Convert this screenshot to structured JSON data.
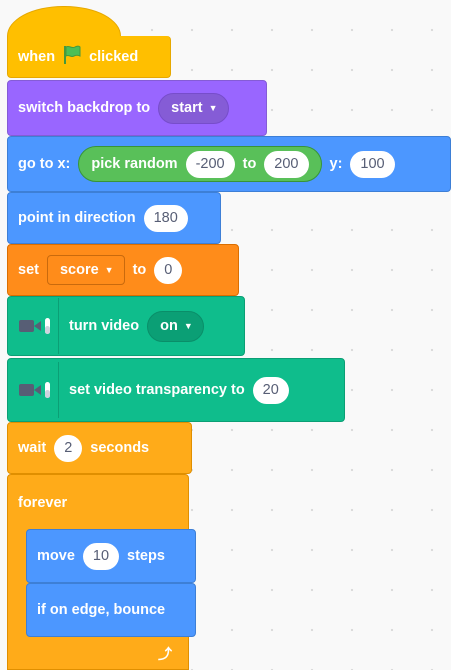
{
  "blocks": {
    "when_flag": {
      "prefix": "when",
      "suffix": "clicked",
      "flag_icon": "green-flag-icon"
    },
    "switch_backdrop": {
      "label": "switch backdrop to",
      "value": "start"
    },
    "goto": {
      "label": "go to x:",
      "pick_random": "pick random",
      "from": "-200",
      "to_label": "to",
      "to": "200",
      "y_label": "y:",
      "y": "100"
    },
    "point": {
      "label": "point in direction",
      "value": "180"
    },
    "set_var": {
      "label": "set",
      "variable": "score",
      "to_label": "to",
      "value": "0"
    },
    "turn_video": {
      "label": "turn video",
      "value": "on",
      "icon": "video-camera-icon"
    },
    "video_transparency": {
      "label": "set video transparency to",
      "value": "20",
      "icon": "video-camera-icon"
    },
    "wait": {
      "label": "wait",
      "value": "2",
      "suffix": "seconds"
    },
    "forever": {
      "label": "forever",
      "loop_icon": "loop-arrow-icon"
    },
    "move": {
      "label": "move",
      "value": "10",
      "suffix": "steps"
    },
    "bounce": {
      "label": "if on edge, bounce"
    }
  },
  "colors": {
    "events": "#ffbf00",
    "looks": "#9966ff",
    "motion": "#4c97ff",
    "variables": "#ff8c1a",
    "video_sensing": "#0fbd8c",
    "control": "#ffab19",
    "operators": "#59c059"
  }
}
